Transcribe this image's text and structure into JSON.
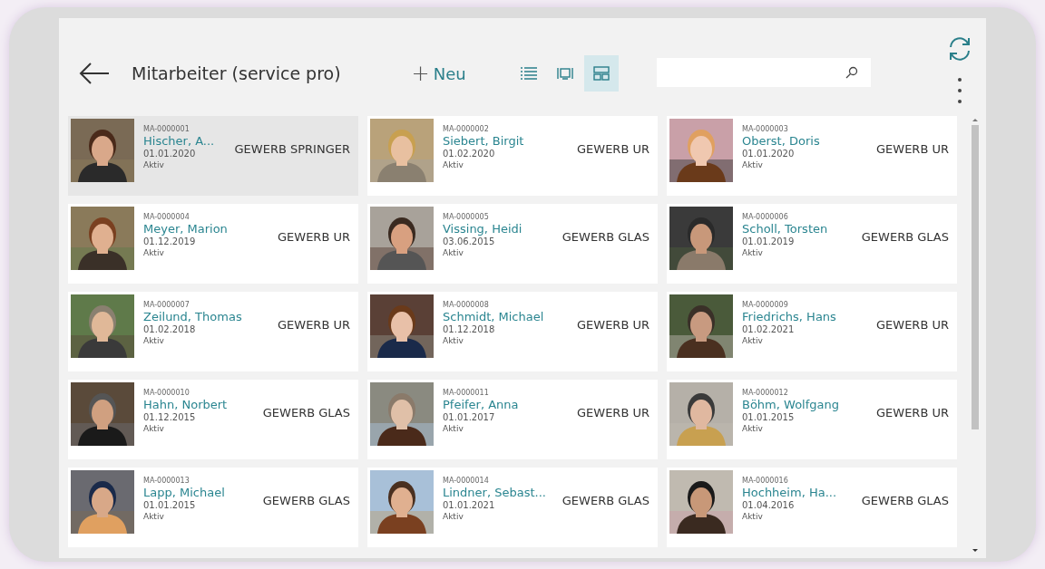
{
  "header": {
    "title": "Mitarbeiter (service pro)",
    "new_button": {
      "icon": "+",
      "label": "Neu"
    }
  },
  "view_buttons": [
    {
      "kind": "list",
      "selected": false
    },
    {
      "kind": "tile",
      "selected": false
    },
    {
      "kind": "grid",
      "selected": true
    }
  ],
  "employees": [
    {
      "id": "MA-0000001",
      "name": "Hischer, A...",
      "date": "01.01.2020",
      "status": "Aktiv",
      "group": "GEWERB SPRINGER",
      "selected": true
    },
    {
      "id": "MA-0000002",
      "name": "Siebert, Birgit",
      "date": "01.02.2020",
      "status": "Aktiv",
      "group": "GEWERB UR",
      "selected": false
    },
    {
      "id": "MA-0000003",
      "name": "Oberst, Doris",
      "date": "01.01.2020",
      "status": "Aktiv",
      "group": "GEWERB UR",
      "selected": false
    },
    {
      "id": "MA-0000004",
      "name": "Meyer, Marion",
      "date": "01.12.2019",
      "status": "Aktiv",
      "group": "GEWERB UR",
      "selected": false
    },
    {
      "id": "MA-0000005",
      "name": "Vissing, Heidi",
      "date": "03.06.2015",
      "status": "Aktiv",
      "group": "GEWERB GLAS",
      "selected": false
    },
    {
      "id": "MA-0000006",
      "name": "Scholl, Torsten",
      "date": "01.01.2019",
      "status": "Aktiv",
      "group": "GEWERB GLAS",
      "selected": false
    },
    {
      "id": "MA-0000007",
      "name": "Zeilund, Thomas",
      "date": "01.02.2018",
      "status": "Aktiv",
      "group": "GEWERB UR",
      "selected": false
    },
    {
      "id": "MA-0000008",
      "name": "Schmidt, Michael",
      "date": "01.12.2018",
      "status": "Aktiv",
      "group": "GEWERB UR",
      "selected": false
    },
    {
      "id": "MA-0000009",
      "name": "Friedrichs, Hans",
      "date": "01.02.2021",
      "status": "Aktiv",
      "group": "GEWERB UR",
      "selected": false
    },
    {
      "id": "MA-0000010",
      "name": "Hahn, Norbert",
      "date": "01.12.2015",
      "status": "Aktiv",
      "group": "GEWERB GLAS",
      "selected": false
    },
    {
      "id": "MA-0000011",
      "name": "Pfeifer, Anna",
      "date": "01.01.2017",
      "status": "Aktiv",
      "group": "GEWERB UR",
      "selected": false
    },
    {
      "id": "MA-0000012",
      "name": "Böhm, Wolfgang",
      "date": "01.01.2015",
      "status": "Aktiv",
      "group": "GEWERB UR",
      "selected": false
    },
    {
      "id": "MA-0000013",
      "name": "Lapp, Michael",
      "date": "01.01.2015",
      "status": "Aktiv",
      "group": "GEWERB GLAS",
      "selected": false
    },
    {
      "id": "MA-0000014",
      "name": "Lindner, Sebast...",
      "date": "01.01.2021",
      "status": "Aktiv",
      "group": "GEWERB GLAS",
      "selected": false
    },
    {
      "id": "MA-0000016",
      "name": "Hochheim, Ha...",
      "date": "01.04.2016",
      "status": "Aktiv",
      "group": "GEWERB GLAS",
      "selected": false
    }
  ]
}
